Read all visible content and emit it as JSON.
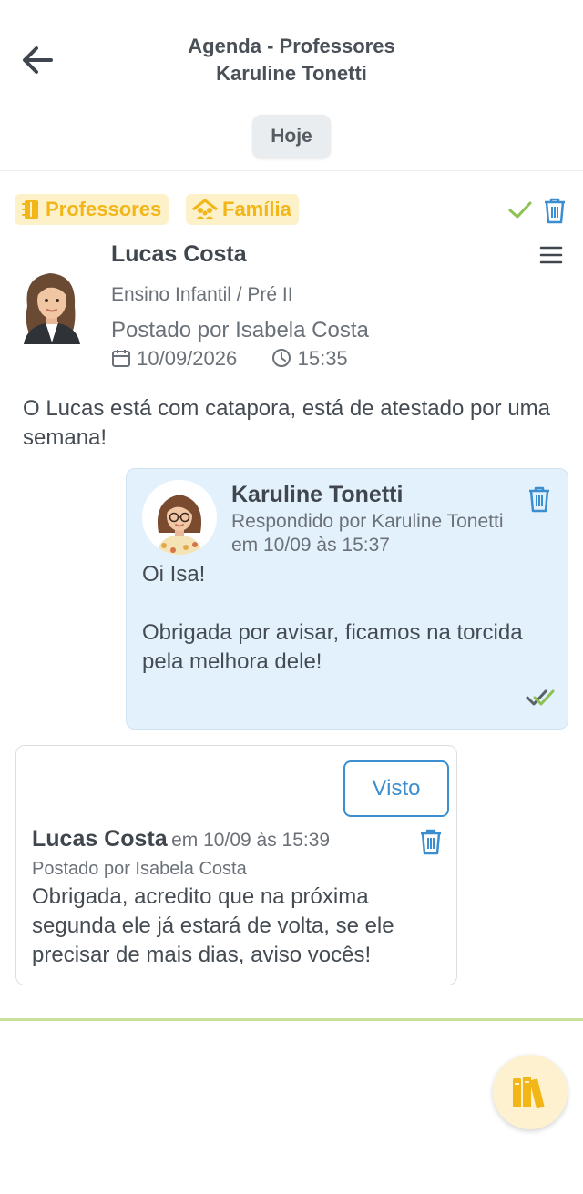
{
  "header": {
    "title_line1": "Agenda - Professores",
    "title_line2": "Karuline Tonetti",
    "today_label": "Hoje",
    "back_icon": "arrow-left-icon"
  },
  "tags": [
    {
      "label": "Professores",
      "icon": "notebook-icon"
    },
    {
      "label": "Família",
      "icon": "family-home-icon"
    }
  ],
  "post": {
    "student_name": "Lucas Costa",
    "class": "Ensino Infantil / Pré II",
    "posted_by": "Postado por Isabela Costa",
    "date": "10/09/2026",
    "time": "15:35",
    "message": "O Lucas está com catapora, está de atestado por uma semana!"
  },
  "reply": {
    "name": "Karuline Tonetti",
    "meta": "Respondido por Karuline Tonetti em 10/09 às 15:37",
    "text": "Oi Isa!\n\nObrigada por avisar, ficamos na torcida pela melhora dele!"
  },
  "response": {
    "visto_label": "Visto",
    "name": "Lucas Costa",
    "time": "em 10/09 às 15:39",
    "posted_by": "Postado por Isabela Costa",
    "text": "Obrigada, acredito que na próxima segunda ele já estará de volta, se ele precisar de mais dias, aviso vocês!"
  },
  "colors": {
    "tag_bg": "#fdf1c9",
    "tag_text": "#f2b619",
    "accent_blue": "#3b8fd0",
    "reply_bg": "#e3f1fd",
    "check_green": "#8cc152",
    "divider": "#c8df9d"
  }
}
